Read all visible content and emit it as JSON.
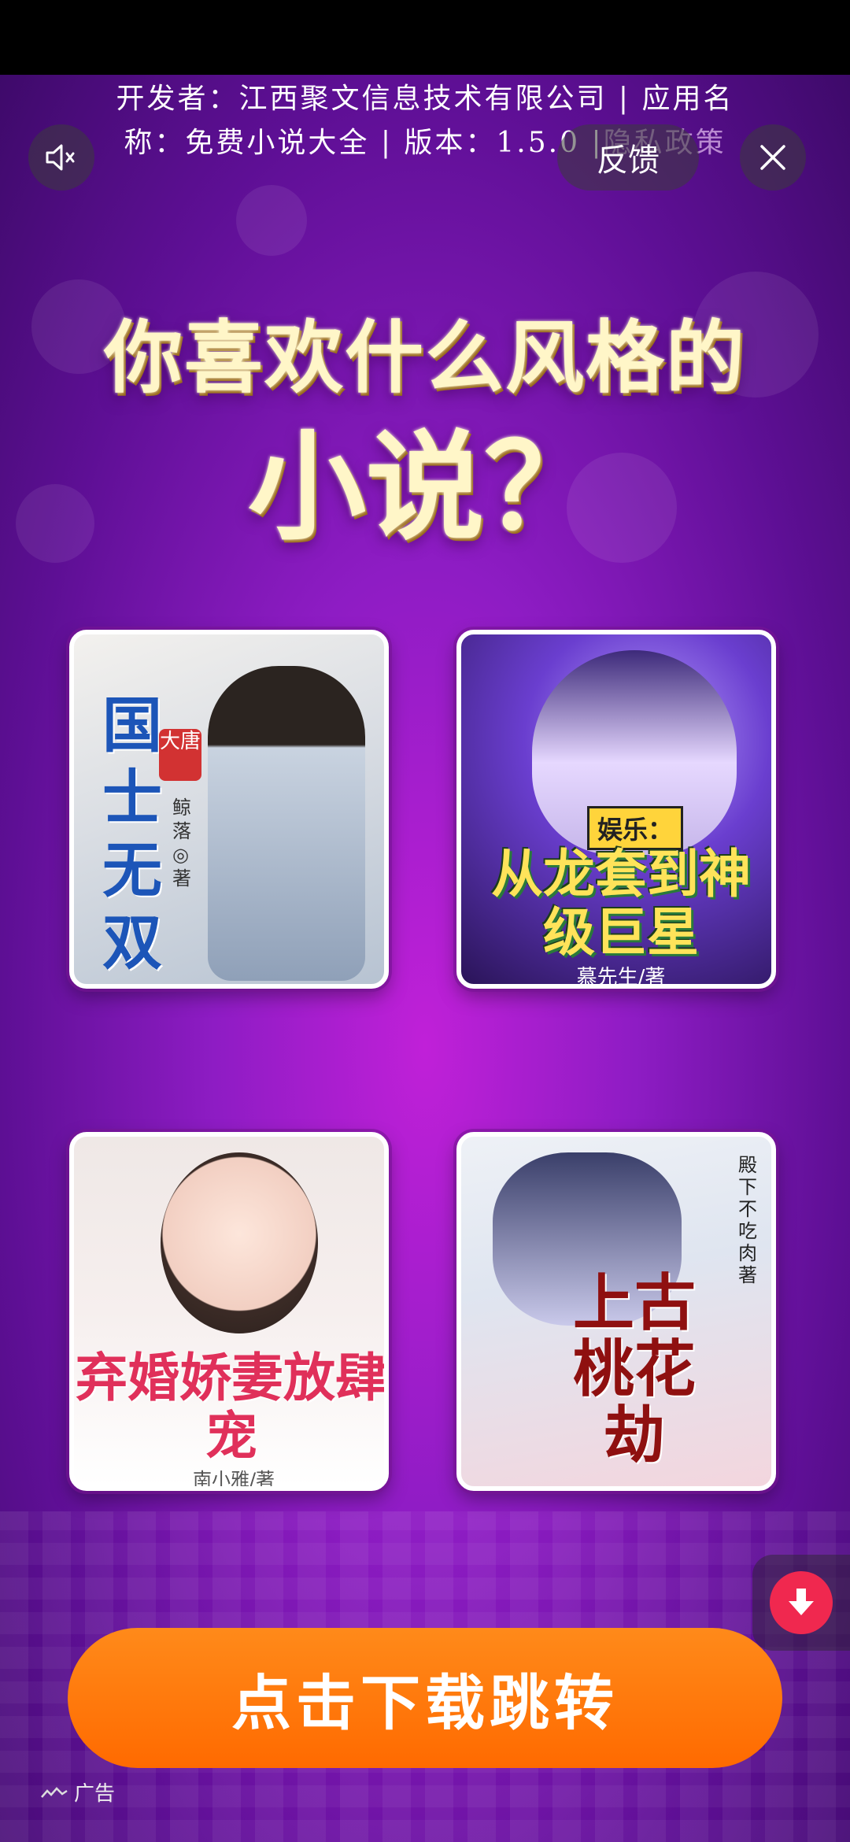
{
  "developer_info": {
    "line1": "开发者：江西聚文信息技术有限公司 | 应用名",
    "line2": "称：免费小说大全 | 版本：1.5.0 |",
    "policy": "隐私政策"
  },
  "controls": {
    "feedback_label": "反馈"
  },
  "headline": {
    "line1": "你喜欢什么风格的",
    "line2": "小说？"
  },
  "covers": [
    {
      "title": "国士无双",
      "badge": "大唐",
      "author": "鲸落◎著"
    },
    {
      "tag": "娱乐：",
      "title": "从龙套到神级巨星",
      "author": "慕先生/著"
    },
    {
      "title": "弃婚娇妻放肆宠",
      "author": "南小雅/著"
    },
    {
      "title": "上古桃花劫",
      "author": "殿下不吃肉著"
    }
  ],
  "cta": {
    "label": "点击下载跳转"
  },
  "ad": {
    "label": "广告"
  },
  "colors": {
    "cta": "#ff6a00",
    "download_badge": "#f0284f",
    "background": "#8e1cc4"
  }
}
